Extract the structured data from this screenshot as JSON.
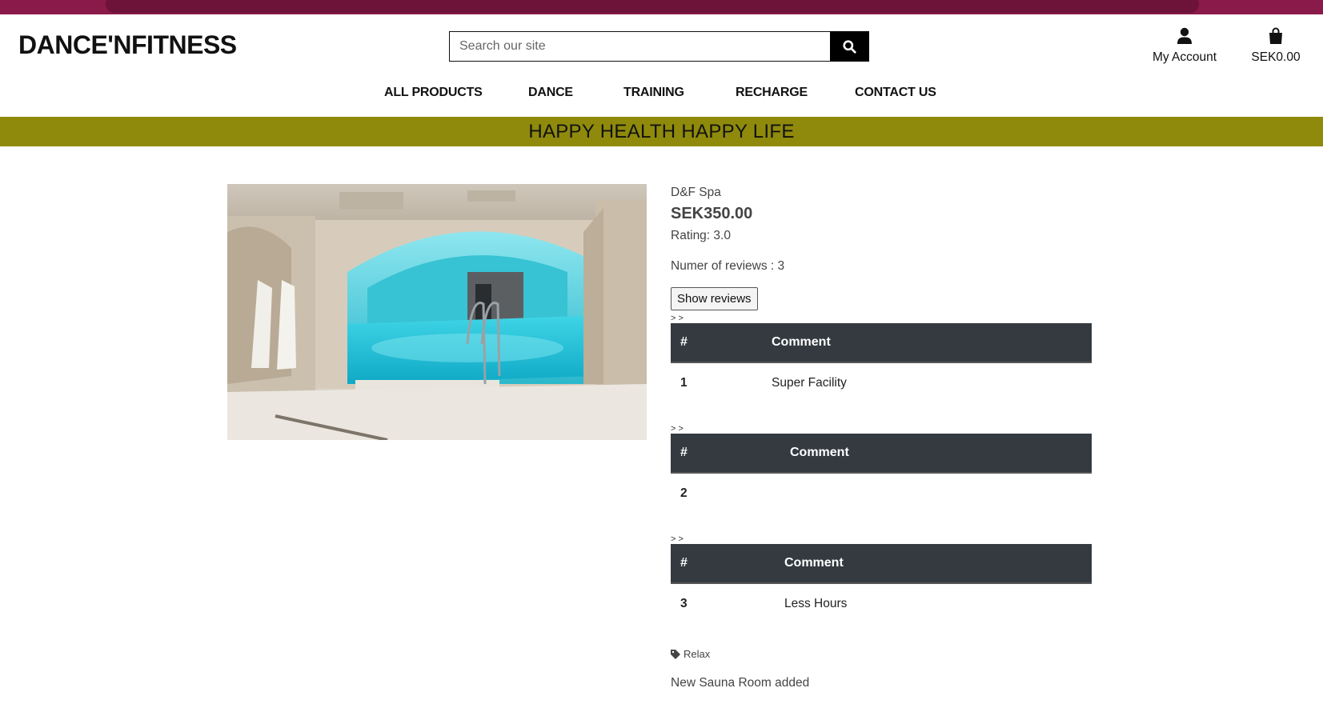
{
  "header": {
    "logo": "DANCE'NFITNESS",
    "search_placeholder": "Search our site",
    "account_label": "My Account",
    "bag_total": "SEK0.00"
  },
  "nav": {
    "items": [
      "ALL PRODUCTS",
      "DANCE",
      "TRAINING",
      "RECHARGE",
      "CONTACT US"
    ]
  },
  "banner": {
    "text": "HAPPY HEALTH HAPPY LIFE"
  },
  "product": {
    "name": "D&F Spa",
    "price": "SEK350.00",
    "rating": "Rating: 3.0",
    "num_reviews": "Numer of reviews : 3",
    "show_reviews_label": "Show reviews",
    "tag": "Relax",
    "description": "New Sauna Room added"
  },
  "reviews": {
    "marker": "> >",
    "col_hash": "#",
    "col_comment": "Comment",
    "items": [
      {
        "num": "1",
        "comment": "Super Facility"
      },
      {
        "num": "2",
        "comment": ""
      },
      {
        "num": "3",
        "comment": "Less Hours"
      }
    ]
  },
  "colors": {
    "browser_chrome": "#8a1a4a",
    "banner": "#8f8a0b",
    "table_header": "#343a40"
  },
  "icons": {
    "search": "search-icon",
    "account": "user-icon",
    "bag": "shopping-bag-icon",
    "tag": "tag-icon"
  }
}
